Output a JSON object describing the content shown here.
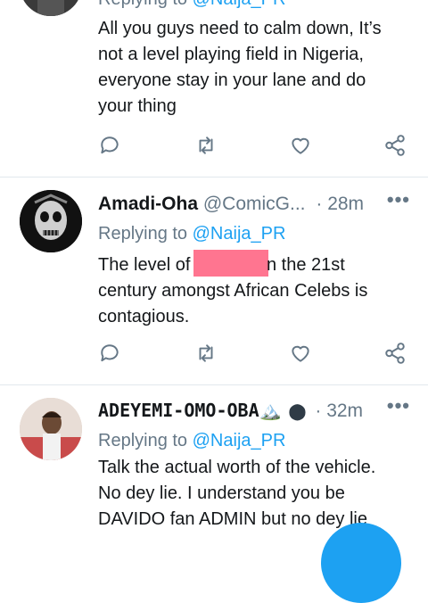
{
  "tweets": [
    {
      "avatar_icon": "avatar-partial",
      "replying_prefix": "Replying to",
      "replying_handle": "@Naija_PR",
      "text": "All you guys need to calm down, It’s not a level playing field in Nigeria, everyone stay in your lane  and do your thing",
      "lines": [
        "All you guys need to calm down, It’s",
        "not a level playing field in Nigeria,",
        "everyone stay in your lane  and do",
        "your thing"
      ]
    },
    {
      "name": "Amadi-Oha",
      "handle": "@ComicG...",
      "time": "· 28m",
      "replying_prefix": "Replying to",
      "replying_handle": "@Naija_PR",
      "line1_a": "The level of ",
      "line1_b": "n the 21st",
      "line2": "century amongst African Celebs is",
      "line3": "contagious."
    },
    {
      "name": "ADEYEMI-OMO-OBA🏔️",
      "handle_badge": "⬤",
      "time": "· 32m",
      "replying_prefix": "Replying to",
      "replying_handle": "@Naija_PR",
      "lines": [
        "Talk the actual worth of the vehicle.",
        "No dey lie. I understand you be",
        "DAVIDO fan ADMIN but no dey lie"
      ]
    }
  ],
  "more_label": "•••",
  "colors": {
    "accent": "#1da1f2",
    "secondary_text": "#657786",
    "divider": "#e1e8ed",
    "redaction": "#ff7590"
  }
}
